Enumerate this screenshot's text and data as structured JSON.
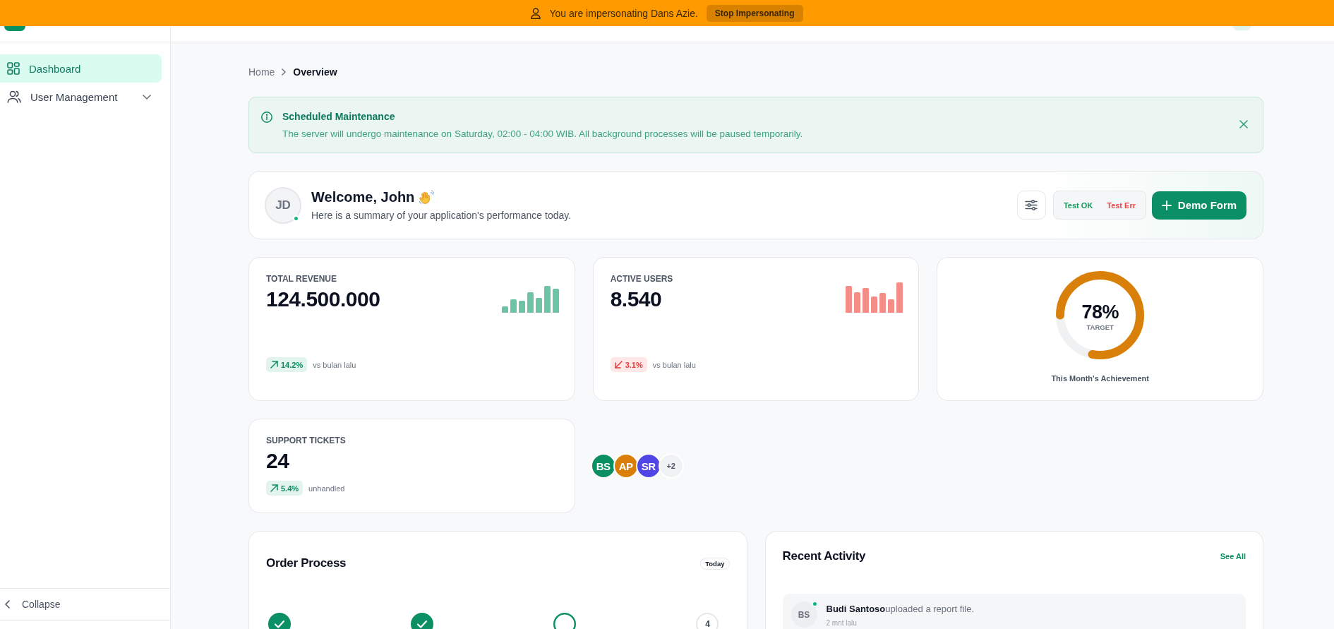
{
  "impersonation_banner": {
    "message": "You are impersonating Dans Azie.",
    "button": "Stop Impersonating"
  },
  "sidebar": {
    "items": [
      {
        "label": "Dashboard",
        "kind": "link",
        "selected": true
      },
      {
        "label": "User Management",
        "kind": "group",
        "selected": false,
        "expanded": false
      }
    ],
    "collapse": "Collapse"
  },
  "breadcrumb": [
    {
      "label": "Home",
      "current": false
    },
    {
      "label": "Overview",
      "current": true
    }
  ],
  "alert": {
    "title": "Scheduled Maintenance",
    "message": "The server will undergo maintenance on Saturday, 02:00 - 04:00 WIB. All background processes will be paused temporarily."
  },
  "welcome": {
    "avatar": "JD",
    "online": true,
    "title": "Welcome, John",
    "subtitle": "Here is a summary of your application's performance today.",
    "test_buttons": [
      {
        "label": "Test OK",
        "kind": "success"
      },
      {
        "label": "Test Err",
        "kind": "error"
      }
    ],
    "primary_button": "Demo Form"
  },
  "stats": [
    {
      "label": "TOTAL REVENUE",
      "value": "124.500.000",
      "trend_up": true,
      "change": "14.2%",
      "note": "vs bulan lalu"
    },
    {
      "label": "ACTIVE USERS",
      "value": "8.540",
      "trend_up": false,
      "change": "3.1%",
      "note": "vs bulan lalu"
    }
  ],
  "target": {
    "value": "78%",
    "label": "TARGET",
    "level": 0.78,
    "caption": "This Month's Achievement"
  },
  "support": {
    "label": "SUPPORT TICKETS",
    "value": "24",
    "trend_up": true,
    "change": "5.4%",
    "note": "unhandled"
  },
  "team_avatars": {
    "avatars": [
      {
        "initials": "BS",
        "color": "#0a8f63"
      },
      {
        "initials": "AP",
        "color": "#d97f0a"
      },
      {
        "initials": "SR",
        "color": "#5146e5"
      }
    ],
    "more": "+2"
  },
  "order_process": {
    "title": "Order Process",
    "badge": "Today",
    "steps": [
      {
        "done": true,
        "current": false
      },
      {
        "done": true,
        "current": false
      },
      {
        "done": false,
        "current": true
      },
      {
        "done": false,
        "current": false,
        "number": "4"
      }
    ]
  },
  "recent_activity": {
    "title": "Recent Activity",
    "link": "See All",
    "items": [
      {
        "initials": "BS",
        "online": true,
        "text": "**Budi Santoso**uploaded a report file.",
        "time": "2 mnt lalu"
      }
    ]
  }
}
